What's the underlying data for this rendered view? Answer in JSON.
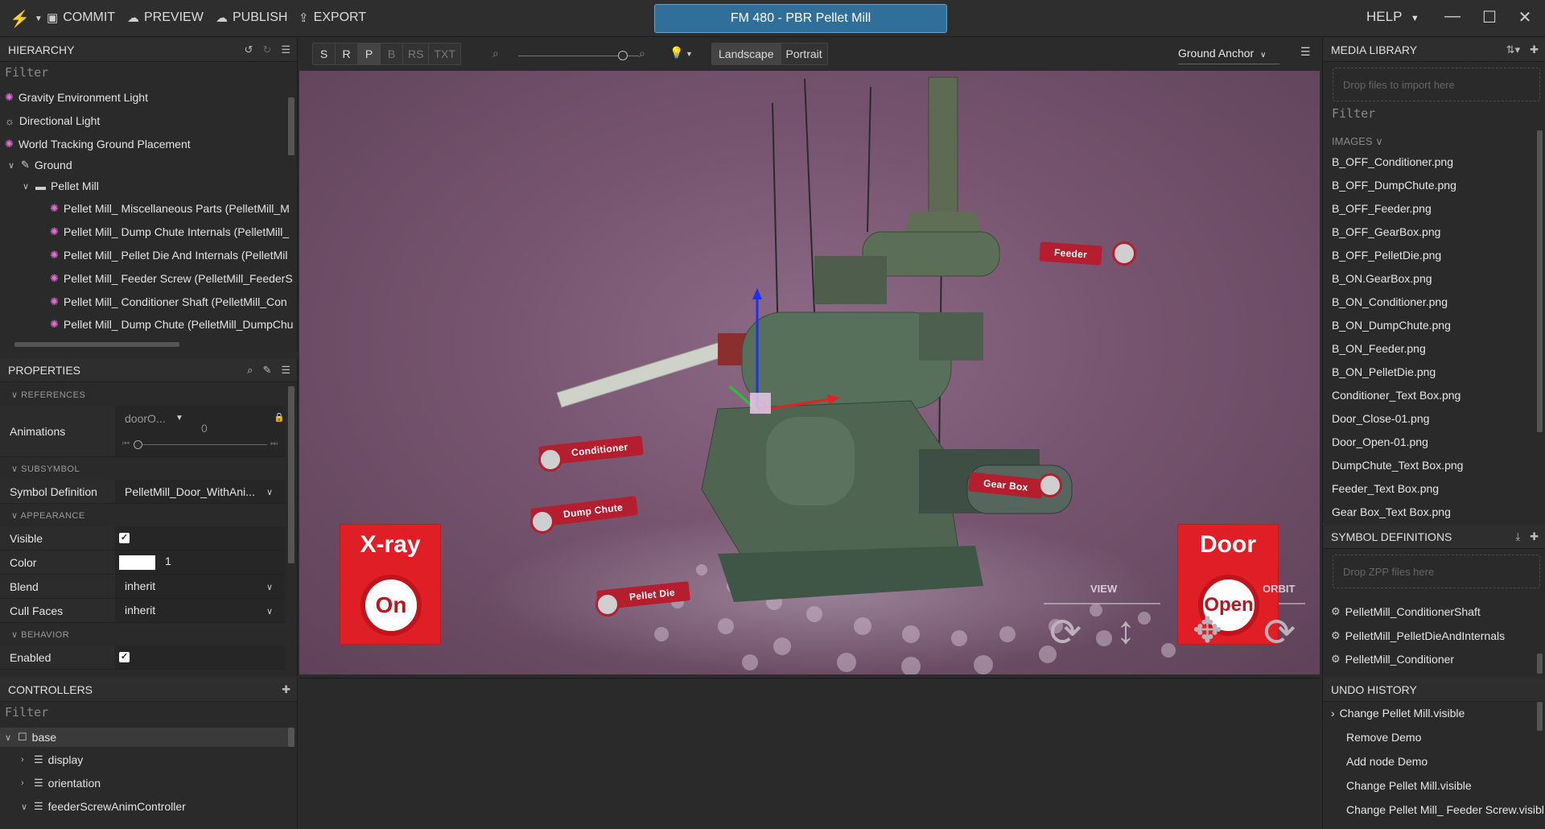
{
  "topbar": {
    "commit": "COMMIT",
    "preview": "PREVIEW",
    "publish": "PUBLISH",
    "export": "EXPORT",
    "project_title": "FM 480 - PBR Pellet Mill",
    "help": "HELP"
  },
  "hierarchy": {
    "title": "HIERARCHY",
    "filter_placeholder": "Filter",
    "items": [
      "Gravity Environment Light",
      "Directional Light",
      "World Tracking Ground Placement",
      "Ground",
      "Pellet Mill",
      "Pellet Mill_ Miscellaneous Parts (PelletMill_M",
      "Pellet Mill_ Dump Chute Internals (PelletMill_",
      "Pellet Mill_ Pellet Die And Internals (PelletMil",
      "Pellet Mill_ Feeder Screw (PelletMill_FeederS",
      "Pellet Mill_ Conditioner Shaft (PelletMill_Con",
      "Pellet Mill_ Dump Chute (PelletMill_DumpChu"
    ]
  },
  "properties": {
    "title": "PROPERTIES",
    "sections": {
      "references": "REFERENCES",
      "subsymbol": "SUBSYMBOL",
      "appearance": "APPEARANCE",
      "behavior": "BEHAVIOR"
    },
    "animations_label": "Animations",
    "animations_value": "doorO...",
    "animations_number": "0",
    "symbol_definition_label": "Symbol Definition",
    "symbol_definition_value": "PelletMill_Door_WithAni...",
    "visible_label": "Visible",
    "color_label": "Color",
    "color_value": "1",
    "blend_label": "Blend",
    "blend_value": "inherit",
    "cull_label": "Cull Faces",
    "cull_value": "inherit",
    "enabled_label": "Enabled"
  },
  "controllers": {
    "title": "CONTROLLERS",
    "filter_placeholder": "Filter",
    "items": [
      "base",
      "display",
      "orientation",
      "feederScrewAnimController"
    ]
  },
  "viewport_toolbar": {
    "modes": [
      "S",
      "R",
      "P",
      "B",
      "RS",
      "TXT"
    ],
    "orientation": [
      "Landscape",
      "Portrait"
    ],
    "anchor": "Ground Anchor"
  },
  "scene": {
    "labels": {
      "feeder": "Feeder",
      "conditioner": "Conditioner",
      "dump_chute": "Dump Chute",
      "gear_box": "Gear Box",
      "pellet_die": "Pellet Die"
    },
    "xray_title": "X-ray",
    "xray_state": "On",
    "door_title": "Door",
    "door_state": "Open",
    "view_label": "VIEW",
    "orbit_label": "ORBIT"
  },
  "media_library": {
    "title": "MEDIA LIBRARY",
    "dropzone": "Drop files to import here",
    "filter_placeholder": "Filter",
    "images_header": "IMAGES",
    "images": [
      "B_OFF_Conditioner.png",
      "B_OFF_DumpChute.png",
      "B_OFF_Feeder.png",
      "B_OFF_GearBox.png",
      "B_OFF_PelletDie.png",
      "B_ON.GearBox.png",
      "B_ON_Conditioner.png",
      "B_ON_DumpChute.png",
      "B_ON_Feeder.png",
      "B_ON_PelletDie.png",
      "Conditioner_Text Box.png",
      "Door_Close-01.png",
      "Door_Open-01.png",
      "DumpChute_Text Box.png",
      "Feeder_Text Box.png",
      "Gear Box_Text Box.png"
    ]
  },
  "symbol_definitions": {
    "title": "SYMBOL DEFINITIONS",
    "dropzone": "Drop ZPP files here",
    "items": [
      "PelletMill_ConditionerShaft",
      "PelletMill_PelletDieAndInternals",
      "PelletMill_Conditioner"
    ]
  },
  "undo_history": {
    "title": "UNDO HISTORY",
    "items": [
      "Change Pellet Mill.visible",
      "Remove Demo",
      "Add node Demo",
      "Change Pellet Mill.visible",
      "Change Pellet Mill_ Feeder Screw.visibl"
    ]
  },
  "colors": {
    "accent": "#2f6f9a",
    "label_red": "#b41e2e",
    "button_red": "#e01e26",
    "icon_pink": "#e56bd6"
  }
}
